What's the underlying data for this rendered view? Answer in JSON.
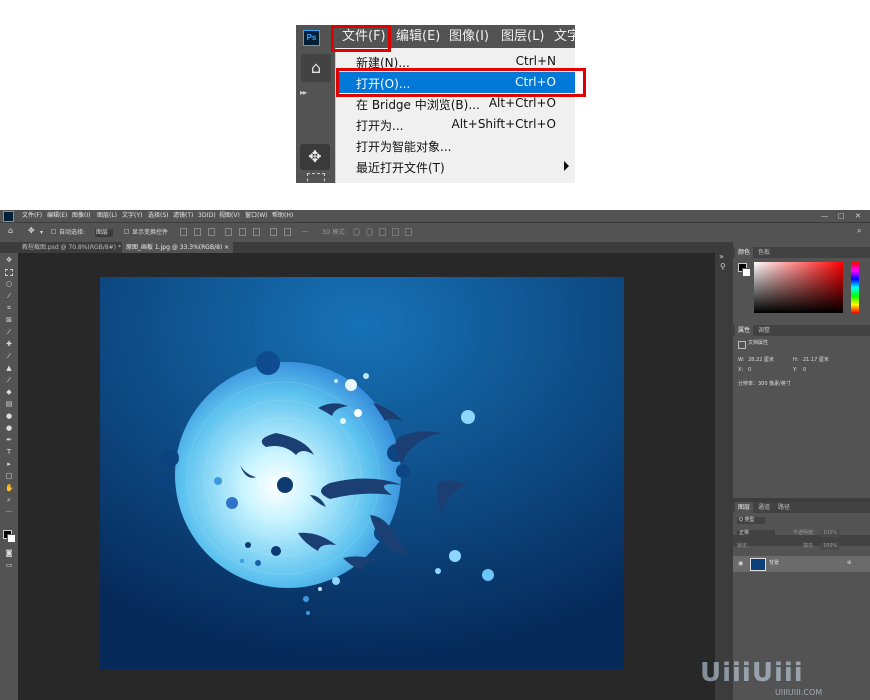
{
  "zoomed_menu": {
    "logo": "Ps",
    "menubar": [
      "文件(F)",
      "编辑(E)",
      "图像(I)",
      "图层(L)",
      "文字"
    ],
    "items": [
      {
        "label": "新建(N)...",
        "shortcut": "Ctrl+N"
      },
      {
        "label": "打开(O)...",
        "shortcut": "Ctrl+O"
      },
      {
        "label": "在 Bridge 中浏览(B)...",
        "shortcut": "Alt+Ctrl+O"
      },
      {
        "label": "打开为...",
        "shortcut": "Alt+Shift+Ctrl+O"
      },
      {
        "label": "打开为智能对象...",
        "shortcut": ""
      },
      {
        "label": "最近打开文件(T)",
        "shortcut": ""
      }
    ],
    "highlighted_item": "打开(O)...",
    "highlight_color": "#0078d7",
    "annotation_color": "#e00000"
  },
  "photoshop": {
    "logo": "Ps",
    "menubar": [
      "文件(F)",
      "编辑(E)",
      "图像(I)",
      "图层(L)",
      "文字(Y)",
      "选择(S)",
      "滤镜(T)",
      "3D(D)",
      "视图(V)",
      "窗口(W)",
      "帮助(H)"
    ],
    "window_controls": [
      "—",
      "□",
      "✕"
    ],
    "options": {
      "auto_select": "自动选择:",
      "layer_select": "图层",
      "show_transform": "显示变换控件",
      "mode_3d": "3D 模式:",
      "more": "···"
    },
    "tabs": [
      {
        "label": "教程截图.psd @ 70.8%(RGB/8#) *"
      },
      {
        "label": "原图_画板 1.jpg @ 33.3%(RGB/8)"
      }
    ],
    "tab_close": "×",
    "panels": {
      "color": {
        "tabs": [
          "颜色",
          "色板"
        ]
      },
      "properties": {
        "tabs": [
          "属性",
          "调整"
        ],
        "doc_label": "文档属性",
        "w_label": "W:",
        "w_value": "28.22 厘米",
        "h_label": "H:",
        "h_value": "21.17 厘米",
        "x_label": "X:",
        "x_value": "0",
        "y_label": "Y:",
        "y_value": "0",
        "resolution": "分辨率：300 像素/英寸"
      },
      "layers": {
        "tabs": [
          "图层",
          "通道",
          "路径"
        ],
        "filter": "Q 类型",
        "blend_mode": "正常",
        "opacity_label": "不透明度:",
        "opacity_value": "100%",
        "lock_label": "锁定:",
        "fill_label": "填充:",
        "fill_value": "100%",
        "layer_name": "背景"
      }
    },
    "colors": {
      "ui_dark": "#282828",
      "ui_panel": "#535353",
      "ocean_top": "#1772b6",
      "ocean_bottom": "#062a5a"
    }
  },
  "watermark": {
    "text": "UiiiUiii",
    "url_text": "UIIIUIII.COM"
  }
}
